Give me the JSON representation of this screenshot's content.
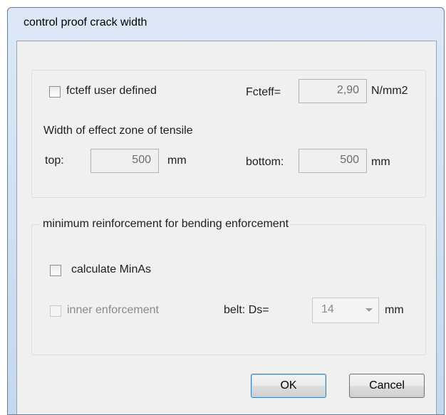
{
  "window": {
    "title": "control proof crack width"
  },
  "group1": {
    "fcteff_checkbox_label": "fcteff user defined",
    "fcteff_label": "Fcteff=",
    "fcteff_value": "2,90",
    "fcteff_unit": "N/mm2",
    "width_heading": "Width of effect zone of tensile",
    "top_label": "top:",
    "top_value": "500",
    "top_unit": "mm",
    "bottom_label": "bottom:",
    "bottom_value": "500",
    "bottom_unit": "mm"
  },
  "group2": {
    "heading": "minimum  reinforcement for bending enforcement",
    "calc_checkbox_label": "calculate MinAs",
    "inner_checkbox_label": "inner enforcement",
    "belt_label": "belt: Ds=",
    "belt_value": "14",
    "belt_unit": "mm"
  },
  "buttons": {
    "ok": "OK",
    "cancel": "Cancel"
  }
}
